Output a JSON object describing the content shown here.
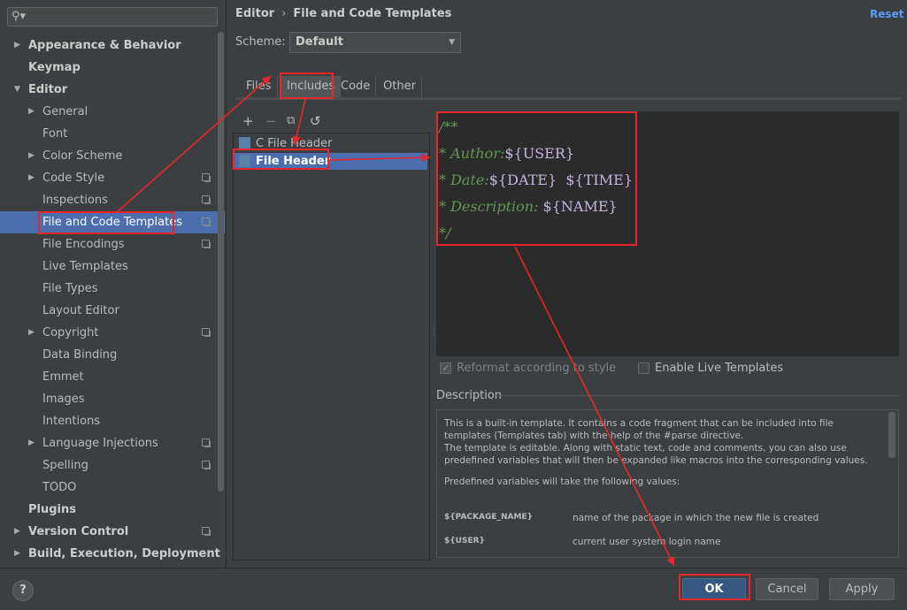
{
  "search": {
    "placeholder": ""
  },
  "sidebar": {
    "items": [
      {
        "label": "Appearance & Behavior",
        "level": 0,
        "arrow": "right"
      },
      {
        "label": "Keymap",
        "level": 0
      },
      {
        "label": "Editor",
        "level": 0,
        "arrow": "down"
      },
      {
        "label": "General",
        "level": 1,
        "arrow": "right"
      },
      {
        "label": "Font",
        "level": 1
      },
      {
        "label": "Color Scheme",
        "level": 1,
        "arrow": "right"
      },
      {
        "label": "Code Style",
        "level": 1,
        "arrow": "right",
        "cfg": true
      },
      {
        "label": "Inspections",
        "level": 1,
        "cfg": true
      },
      {
        "label": "File and Code Templates",
        "level": 1,
        "cfg": true,
        "selected": true
      },
      {
        "label": "File Encodings",
        "level": 1,
        "cfg": true
      },
      {
        "label": "Live Templates",
        "level": 1
      },
      {
        "label": "File Types",
        "level": 1
      },
      {
        "label": "Layout Editor",
        "level": 1
      },
      {
        "label": "Copyright",
        "level": 1,
        "arrow": "right",
        "cfg": true
      },
      {
        "label": "Data Binding",
        "level": 1
      },
      {
        "label": "Emmet",
        "level": 1
      },
      {
        "label": "Images",
        "level": 1
      },
      {
        "label": "Intentions",
        "level": 1
      },
      {
        "label": "Language Injections",
        "level": 1,
        "arrow": "right",
        "cfg": true
      },
      {
        "label": "Spelling",
        "level": 1,
        "cfg": true
      },
      {
        "label": "TODO",
        "level": 1
      },
      {
        "label": "Plugins",
        "level": 0
      },
      {
        "label": "Version Control",
        "level": 0,
        "arrow": "right",
        "cfg": true
      },
      {
        "label": "Build, Execution, Deployment",
        "level": 0,
        "arrow": "right"
      }
    ]
  },
  "header": {
    "crumb_parent": "Editor",
    "crumb_sep": "›",
    "crumb_current": "File and Code Templates",
    "reset_label": "Reset",
    "scheme_label": "Scheme:",
    "scheme_value": "Default"
  },
  "tabs": [
    {
      "label": "Files"
    },
    {
      "label": "Includes",
      "active": true
    },
    {
      "label": "Code"
    },
    {
      "label": "Other"
    }
  ],
  "list_toolbar": {
    "add": "+",
    "remove": "−",
    "copy": "⧉",
    "reset": "↺"
  },
  "templates": [
    {
      "label": "C File Header",
      "icon": "c-file-icon"
    },
    {
      "label": "File Header",
      "icon": "java-file-icon",
      "selected": true
    }
  ],
  "editor": {
    "lines": [
      [
        {
          "t": "/**",
          "c": "cmt"
        }
      ],
      [
        {
          "t": "* Author:",
          "c": "cmt"
        },
        {
          "t": "${USER}",
          "c": "var"
        }
      ],
      [
        {
          "t": "* Date:",
          "c": "cmt"
        },
        {
          "t": "${DATE}",
          "c": "var"
        },
        {
          "t": "  ",
          "c": "var"
        },
        {
          "t": "${TIME}",
          "c": "var"
        }
      ],
      [
        {
          "t": "* Description: ",
          "c": "cmt"
        },
        {
          "t": "${NAME}",
          "c": "var"
        }
      ],
      [
        {
          "t": "*/",
          "c": "cmt"
        }
      ]
    ]
  },
  "options": {
    "reformat_label": "Reformat according to style",
    "reformat_checked": true,
    "live_label": "Enable Live Templates",
    "live_checked": false
  },
  "description": {
    "title": "Description",
    "para1": "This is a built-in template. It contains a code fragment that can be included into file templates (Templates tab) with the help of the #parse directive.",
    "para2": "The template is editable. Along with static text, code and comments, you can also use predefined variables that will then be expanded like macros into the corresponding values.",
    "para3": "Predefined variables will take the following values:",
    "vars": [
      {
        "name": "${PACKAGE_NAME}",
        "desc": "name of the package in which the new file is created"
      },
      {
        "name": "${USER}",
        "desc": "current user system login name"
      }
    ]
  },
  "footer": {
    "help": "?",
    "ok": "OK",
    "cancel": "Cancel",
    "apply": "Apply"
  },
  "colors": {
    "accent": "#4b6eaf",
    "link": "#589df6",
    "annotation": "#e8262b",
    "comment": "#629755"
  }
}
